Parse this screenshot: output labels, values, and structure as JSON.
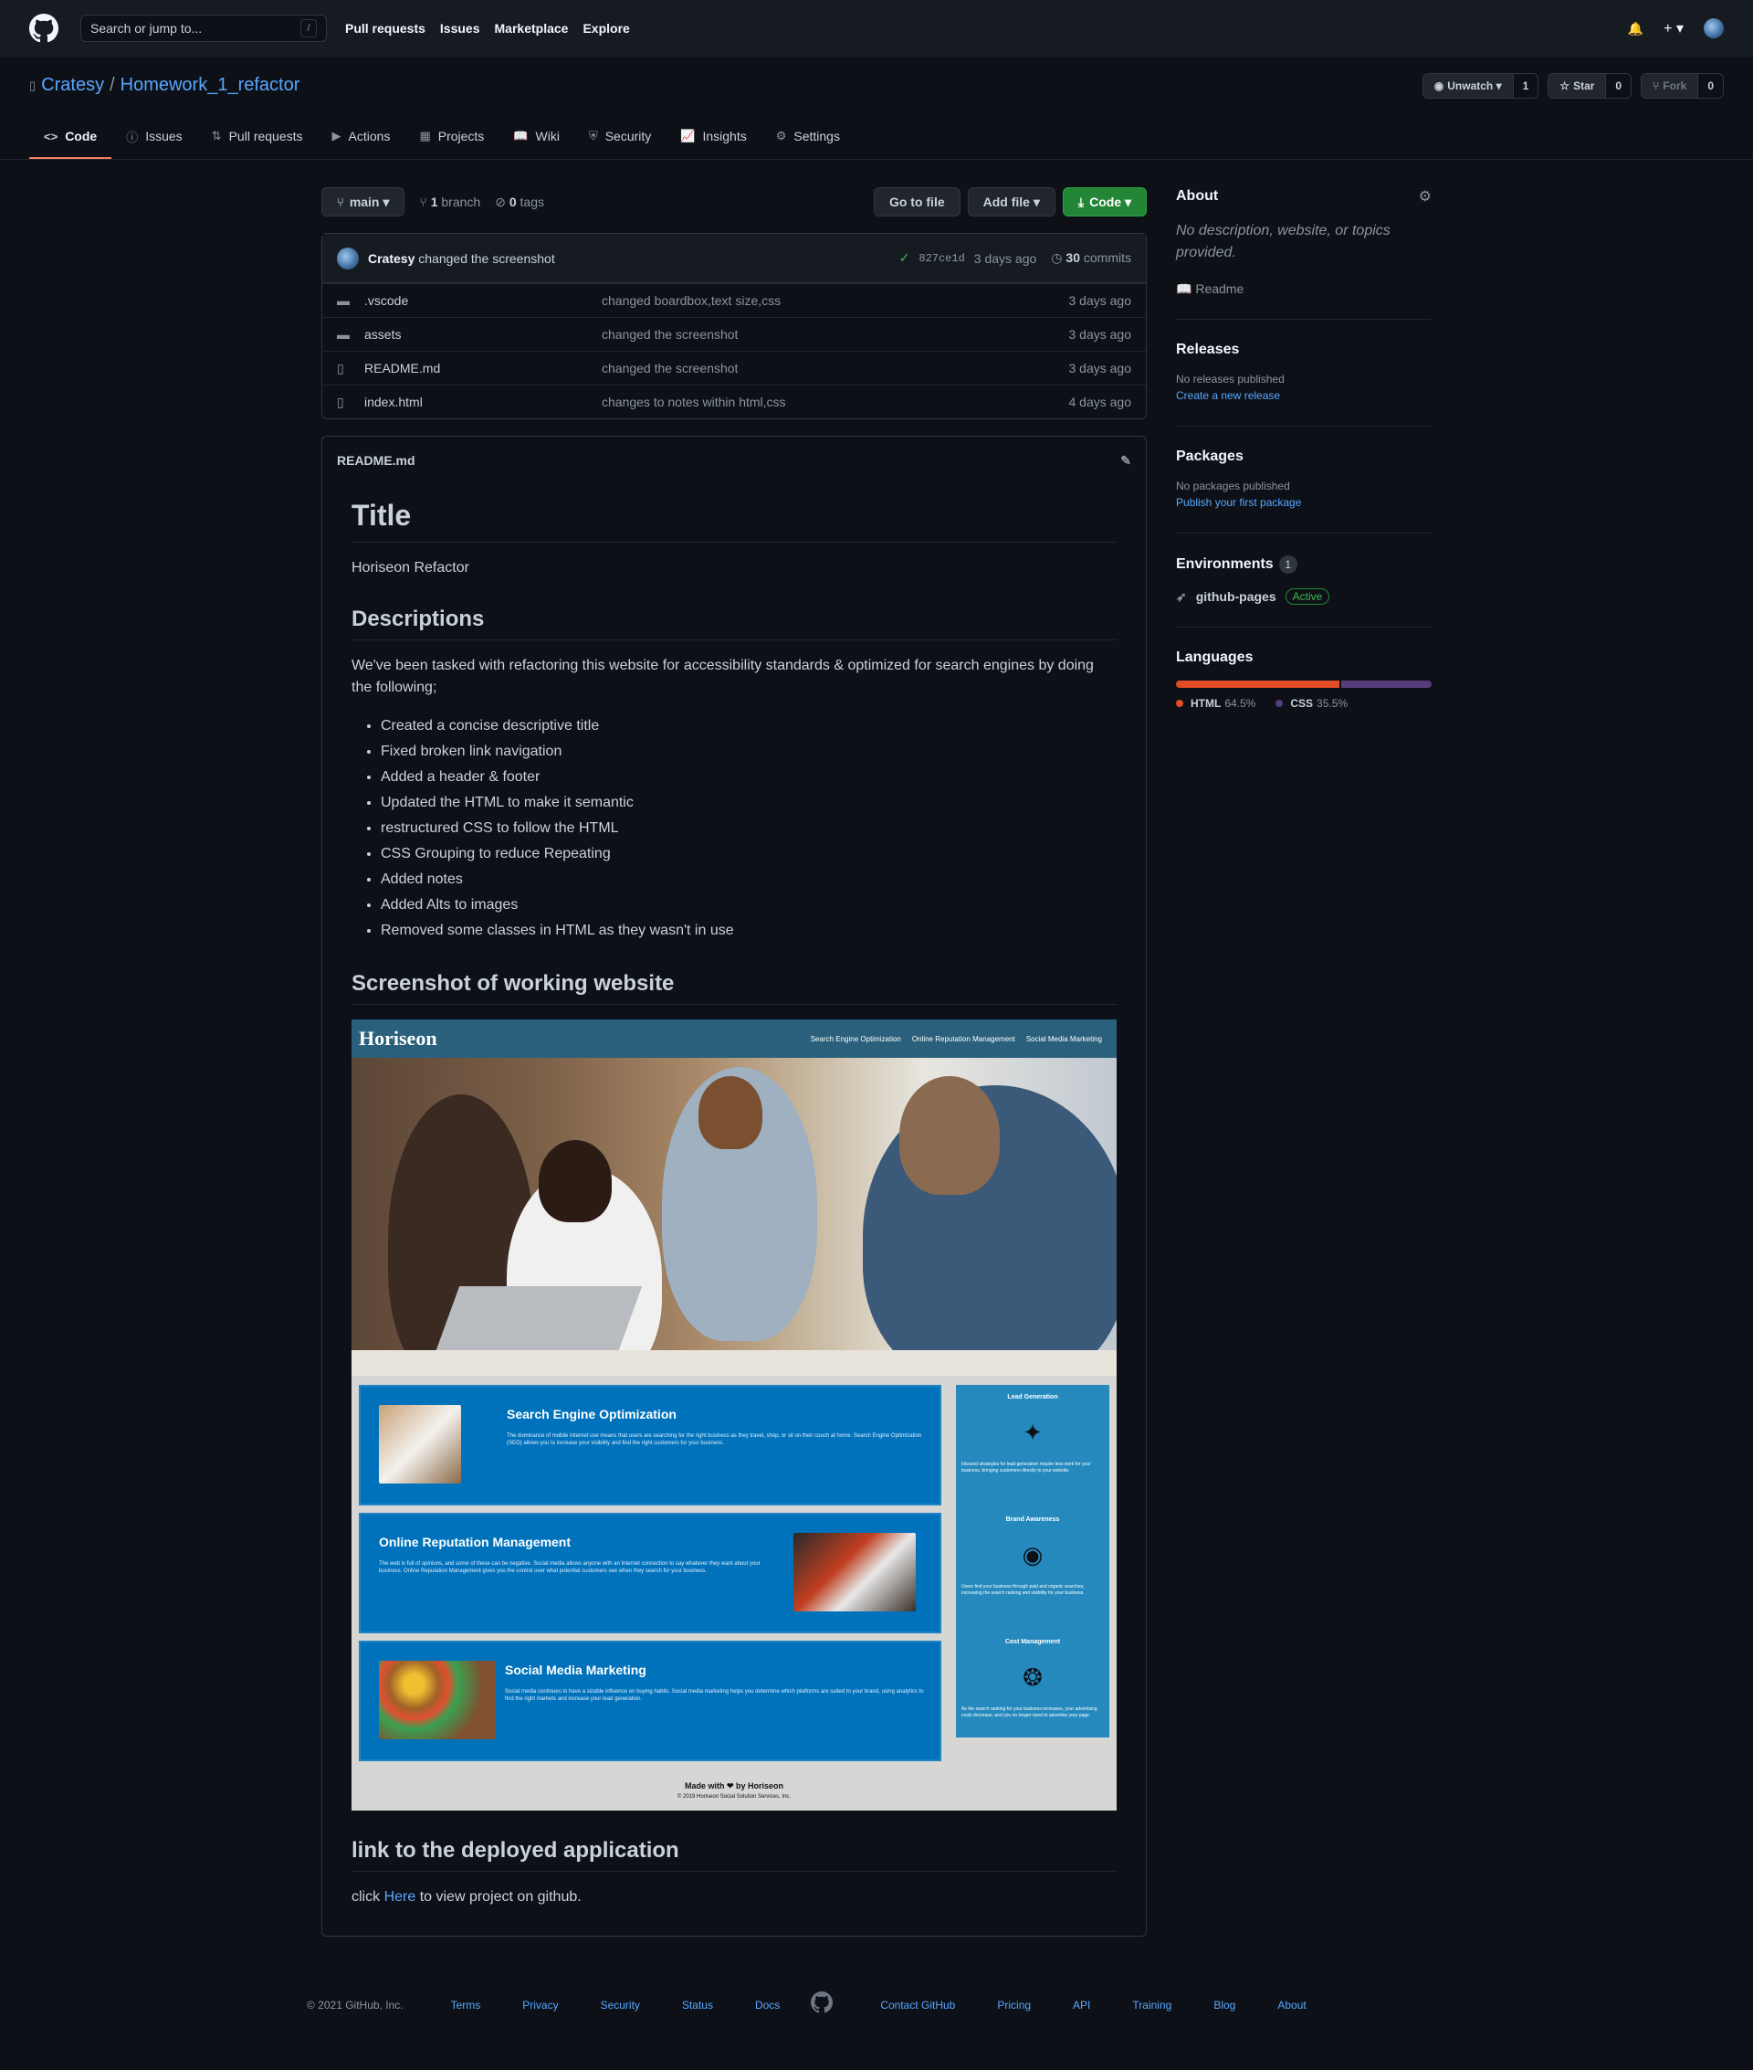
{
  "header": {
    "search_placeholder": "Search or jump to...",
    "search_shortcut": "/",
    "nav": [
      "Pull requests",
      "Issues",
      "Marketplace",
      "Explore"
    ],
    "plus": "+ ▾",
    "bell": "🔔"
  },
  "repo": {
    "owner": "Cratesy",
    "separator": "/",
    "name": "Homework_1_refactor",
    "unwatch_label": "Unwatch ▾",
    "watch_count": "1",
    "star_label": "Star",
    "star_count": "0",
    "fork_label": "Fork",
    "fork_count": "0"
  },
  "tabs": [
    {
      "label": "Code",
      "icon": "<>"
    },
    {
      "label": "Issues",
      "icon": "ⓘ"
    },
    {
      "label": "Pull requests",
      "icon": "⇅"
    },
    {
      "label": "Actions",
      "icon": "▶"
    },
    {
      "label": "Projects",
      "icon": "▦"
    },
    {
      "label": "Wiki",
      "icon": "📖"
    },
    {
      "label": "Security",
      "icon": "⛨"
    },
    {
      "label": "Insights",
      "icon": "📈"
    },
    {
      "label": "Settings",
      "icon": "⚙"
    }
  ],
  "toolbar": {
    "branch": "main ▾",
    "branch_count": "1",
    "branch_label": "branch",
    "tag_count": "0",
    "tag_label": "tags",
    "goto_file": "Go to file",
    "add_file": "Add file ▾",
    "code": "Code ▾"
  },
  "commit": {
    "author": "Cratesy",
    "message": "changed the screenshot",
    "check": "✓",
    "sha": "827ce1d",
    "age": "3 days ago",
    "count": "30",
    "count_label": "commits"
  },
  "files": [
    {
      "icon": "folder-icon",
      "glyph": "▬",
      "name": ".vscode",
      "message": "changed boardbox,text size,css",
      "age": "3 days ago"
    },
    {
      "icon": "folder-icon",
      "glyph": "▬",
      "name": "assets",
      "message": "changed the screenshot",
      "age": "3 days ago"
    },
    {
      "icon": "file-icon",
      "glyph": "▯",
      "name": "README.md",
      "message": "changed the screenshot",
      "age": "3 days ago"
    },
    {
      "icon": "file-icon",
      "glyph": "▯",
      "name": "index.html",
      "message": "changes to notes within html,css",
      "age": "4 days ago"
    }
  ],
  "readme": {
    "filename": "README.md",
    "h1": "Title",
    "p1": "Horiseon Refactor",
    "h2_desc": "Descriptions",
    "p2": "We've been tasked with refactoring this website for accessibility standards & optimized for search engines by doing the following;",
    "list": [
      "Created a concise descriptive title",
      "Fixed broken link navigation",
      "Added a header & footer",
      "Updated the HTML to make it semantic",
      "restructured CSS to follow the HTML",
      "CSS Grouping to reduce Repeating",
      "Added notes",
      "Added Alts to images",
      "Removed some classes in HTML as they wasn't in use"
    ],
    "h2_shot": "Screenshot of working website",
    "h2_link": "link to the deployed application",
    "link_pre": "click",
    "link_text": "Here",
    "link_post": "to view project on github."
  },
  "screenshot": {
    "brand": "Horiseon",
    "nav": [
      "Search Engine Optimization",
      "Online Reputation Management",
      "Social Media Marketing"
    ],
    "cards": [
      {
        "title": "Search Engine Optimization",
        "text": "The dominance of mobile Internet use means that users are searching for the right business as they travel, shop, or sit on their couch at home. Search Engine Optimization (SEO) allows you to increase your visibility and find the right customers for your business."
      },
      {
        "title": "Online Reputation Management",
        "text": "The web is full of opinions, and some of these can be negative. Social media allows anyone with an Internet connection to say whatever they want about your business. Online Reputation Management gives you the control over what potential customers see when they search for your business."
      },
      {
        "title": "Social Media Marketing",
        "text": "Social media continues to have a sizable influence on buying habits. Social media marketing helps you determine which platforms are suited to your brand, using analytics to find the right markets and increase your lead generation."
      }
    ],
    "benefits": [
      {
        "title": "Lead Generation",
        "glyph": "✦",
        "text": "Inbound strategies for lead generation require less work for your business, bringing customers directly to your website."
      },
      {
        "title": "Brand Awareness",
        "glyph": "◉",
        "text": "Users find your business through paid and organic searches, increasing the search ranking and visibility for your business."
      },
      {
        "title": "Cost Management",
        "glyph": "❂",
        "text": "As the search ranking for your business increases, your advertising costs decrease, and you no longer need to advertise your page."
      }
    ],
    "footer_made": "Made with ❤ by Horiseon",
    "footer_copy": "© 2019 Horiseon Social Solution Services, Inc."
  },
  "sidebar": {
    "about_title": "About",
    "about_text": "No description, website, or topics provided.",
    "readme_label": "Readme",
    "releases_title": "Releases",
    "releases_none": "No releases published",
    "releases_link": "Create a new release",
    "packages_title": "Packages",
    "packages_none": "No packages published",
    "packages_link": "Publish your first package",
    "env_title": "Environments",
    "env_count": "1",
    "env_name": "github-pages",
    "env_status": "Active",
    "lang_title": "Languages",
    "languages": [
      {
        "name": "HTML",
        "pct": "64.5%",
        "value": 64.5,
        "color": "#e34c26"
      },
      {
        "name": "CSS",
        "pct": "35.5%",
        "value": 35.5,
        "color": "#563d7c"
      }
    ]
  },
  "footer": {
    "copy": "© 2021 GitHub, Inc.",
    "left_links": [
      "Terms",
      "Privacy",
      "Security",
      "Status",
      "Docs"
    ],
    "right_links": [
      "Contact GitHub",
      "Pricing",
      "API",
      "Training",
      "Blog",
      "About"
    ]
  }
}
